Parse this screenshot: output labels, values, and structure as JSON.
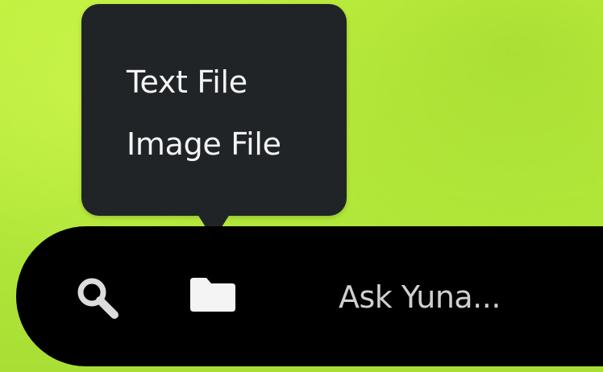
{
  "menu": {
    "items": [
      {
        "label": "Text File"
      },
      {
        "label": "Image File"
      }
    ]
  },
  "bar": {
    "search_icon": "search-icon",
    "folder_icon": "folder-icon",
    "ask_placeholder": "Ask Yuna..."
  },
  "colors": {
    "background_green": "#b4e83a",
    "popup_bg": "#212427",
    "bar_bg": "#000000",
    "icon_color": "#f4f4f4"
  }
}
